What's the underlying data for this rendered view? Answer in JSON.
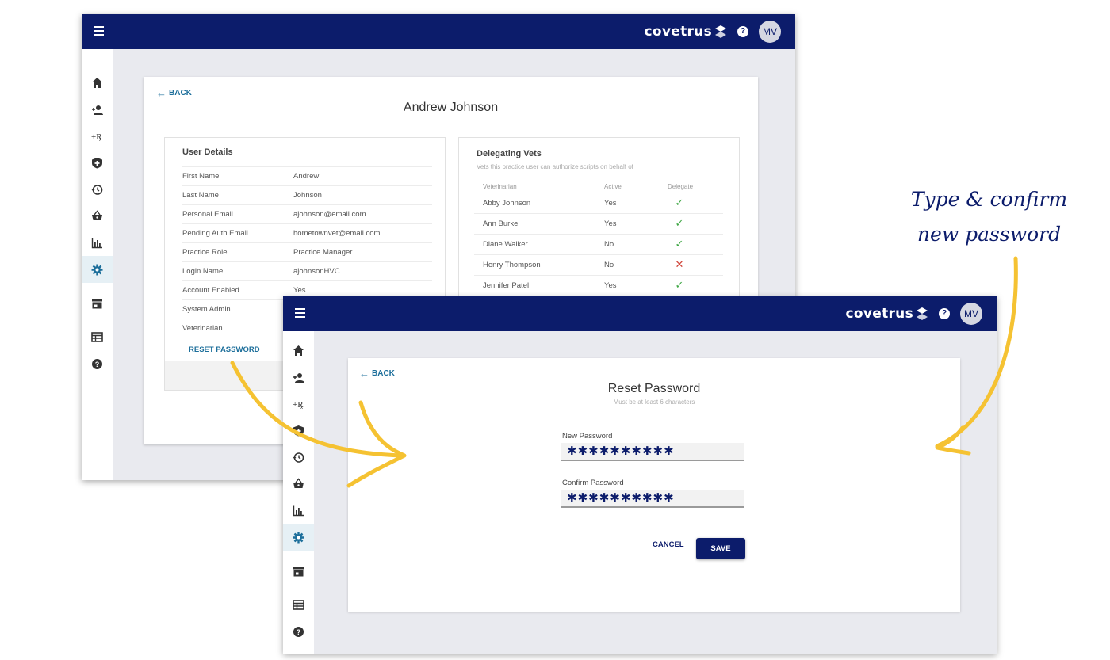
{
  "colors": {
    "navy": "#0c1c6b",
    "link": "#1d6f9b",
    "arrow": "#f5c232",
    "check": "#41a846",
    "cross": "#d0453a"
  },
  "app": {
    "brand": "covetrus",
    "help_icon": "?",
    "avatar_initials": "MV"
  },
  "sidebar": {
    "items": [
      {
        "icon": "home-icon"
      },
      {
        "icon": "add-person-icon"
      },
      {
        "icon": "rx-icon",
        "label": "+Rx"
      },
      {
        "icon": "shield-plus-icon"
      },
      {
        "icon": "history-icon"
      },
      {
        "icon": "basket-icon"
      },
      {
        "icon": "bar-chart-icon"
      },
      {
        "icon": "gear-icon",
        "active": true
      },
      {
        "icon": "store-icon"
      },
      {
        "icon": "table-icon"
      },
      {
        "icon": "help-icon"
      }
    ]
  },
  "user_page": {
    "back_label": "BACK",
    "title": "Andrew Johnson",
    "user_details": {
      "heading": "User Details",
      "rows": [
        {
          "label": "First Name",
          "value": "Andrew"
        },
        {
          "label": "Last Name",
          "value": "Johnson"
        },
        {
          "label": "Personal Email",
          "value": "ajohnson@email.com"
        },
        {
          "label": "Pending Auth Email",
          "value": "hometownvet@email.com"
        },
        {
          "label": "Practice Role",
          "value": "Practice Manager"
        },
        {
          "label": "Login Name",
          "value": "ajohnsonHVC"
        },
        {
          "label": "Account Enabled",
          "value": "Yes"
        },
        {
          "label": "System Admin",
          "value": ""
        },
        {
          "label": "Veterinarian",
          "value": ""
        }
      ],
      "reset_password_label": "RESET PASSWORD"
    },
    "delegating_vets": {
      "heading": "Delegating Vets",
      "subtitle": "Vets this practice user can authorize scripts on behalf of",
      "columns": [
        "Veterinarian",
        "Active",
        "Delegate"
      ],
      "rows": [
        {
          "name": "Abby Johnson",
          "active": "Yes",
          "delegate": true
        },
        {
          "name": "Ann Burke",
          "active": "Yes",
          "delegate": true
        },
        {
          "name": "Diane Walker",
          "active": "No",
          "delegate": true
        },
        {
          "name": "Henry Thompson",
          "active": "No",
          "delegate": false
        },
        {
          "name": "Jennifer Patel",
          "active": "Yes",
          "delegate": true
        }
      ]
    }
  },
  "reset_page": {
    "back_label": "BACK",
    "title": "Reset Password",
    "subtitle": "Must be at least 6 characters",
    "new_password": {
      "label": "New Password",
      "value": "✱✱✱✱✱✱✱✱✱✱"
    },
    "confirm_password": {
      "label": "Confirm Password",
      "value": "✱✱✱✱✱✱✱✱✱✱"
    },
    "cancel_label": "CANCEL",
    "save_label": "SAVE"
  },
  "annotation": {
    "line1": "Type & confirm",
    "line2": "new password"
  }
}
